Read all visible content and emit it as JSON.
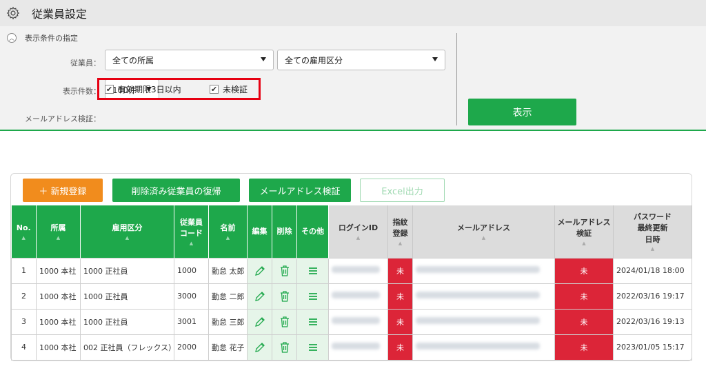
{
  "header": {
    "title": "従業員設定",
    "icon": "gear-icon"
  },
  "filters": {
    "section_label": "表示条件の指定",
    "employee_label": "従業員：",
    "department_value": "全ての所属",
    "employment_value": "全ての雇用区分",
    "count_label": "表示件数：",
    "count_value": "100件",
    "email_verify_label": "メールアドレス検証：",
    "check_expiry_label": "有効期限3日以内",
    "check_expiry_checked": true,
    "check_unverified_label": "未検証",
    "check_unverified_checked": true,
    "show_button": "表示"
  },
  "toolbar": {
    "new_button": "＋ 新規登録",
    "restore_button": "削除済み従業員の復帰",
    "verify_button": "メールアドレス検証",
    "excel_button": "Excel出力"
  },
  "table": {
    "headers": {
      "no": "No.",
      "dept": "所属",
      "emp_type": "雇用区分",
      "emp_code_1": "従業員",
      "emp_code_2": "コード",
      "name": "名前",
      "edit": "編集",
      "delete": "削除",
      "other": "その他",
      "login": "ログインID",
      "finger_1": "指紋",
      "finger_2": "登録",
      "email": "メールアドレス",
      "email_verify_1": "メールアドレス",
      "email_verify_2": "検証",
      "pw_1": "パスワード",
      "pw_2": "最終更新",
      "pw_3": "日時"
    },
    "rows": [
      {
        "no": "1",
        "dept": "1000 本社",
        "emp_type": "1000 正社員",
        "code": "1000",
        "name": "勤怠 太郎",
        "finger": "未",
        "verify": "未",
        "pw_updated": "2024/01/18 18:00"
      },
      {
        "no": "2",
        "dept": "1000 本社",
        "emp_type": "1000 正社員",
        "code": "3000",
        "name": "勤怠 二郎",
        "finger": "未",
        "verify": "未",
        "pw_updated": "2022/03/16 19:17"
      },
      {
        "no": "3",
        "dept": "1000 本社",
        "emp_type": "1000 正社員",
        "code": "3001",
        "name": "勤怠 三郎",
        "finger": "未",
        "verify": "未",
        "pw_updated": "2022/03/16 19:13"
      },
      {
        "no": "4",
        "dept": "1000 本社",
        "emp_type": "002 正社員（フレックス）",
        "code": "2000",
        "name": "勤怠 花子",
        "finger": "未",
        "verify": "未",
        "pw_updated": "2023/01/05 15:17"
      }
    ]
  },
  "colors": {
    "accent": "#1ea84b",
    "orange": "#f18c1d",
    "alert": "#dc2538",
    "highlight": "#e60012"
  }
}
